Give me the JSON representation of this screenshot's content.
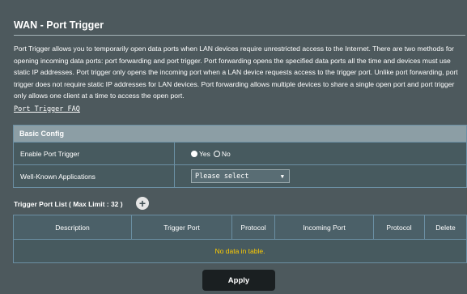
{
  "page": {
    "title": "WAN - Port Trigger",
    "description": "Port Trigger allows you to temporarily open data ports when LAN devices require unrestricted access to the Internet. There are two methods for opening incoming data ports: port forwarding and port trigger. Port forwarding opens the specified data ports all the time and devices must use static IP addresses. Port trigger only opens the incoming port when a LAN device requests access to the trigger port. Unlike port forwarding, port trigger does not require static IP addresses for LAN devices. Port forwarding allows multiple devices to share a single open port and port trigger only allows one client at a time to access the open port.",
    "faq_link": "Port Trigger FAQ"
  },
  "basic_config": {
    "header": "Basic Config",
    "enable_label": "Enable Port Trigger",
    "enable_options": [
      {
        "label": "Yes",
        "checked": true
      },
      {
        "label": "No",
        "checked": false
      }
    ],
    "apps_label": "Well-Known Applications",
    "apps_select_value": "Please select"
  },
  "trigger_list": {
    "title": "Trigger Port List ( Max Limit : 32 )",
    "add_icon": "plus-circle-icon",
    "columns": [
      "Description",
      "Trigger Port",
      "Protocol",
      "Incoming Port",
      "Protocol",
      "Delete"
    ],
    "empty_message": "No data in table."
  },
  "footer": {
    "apply_label": "Apply"
  },
  "colors": {
    "background": "#4d595d",
    "section_header": "#8c9ea5",
    "empty_text": "#ffcc00",
    "apply_button": "#1a1f21"
  }
}
